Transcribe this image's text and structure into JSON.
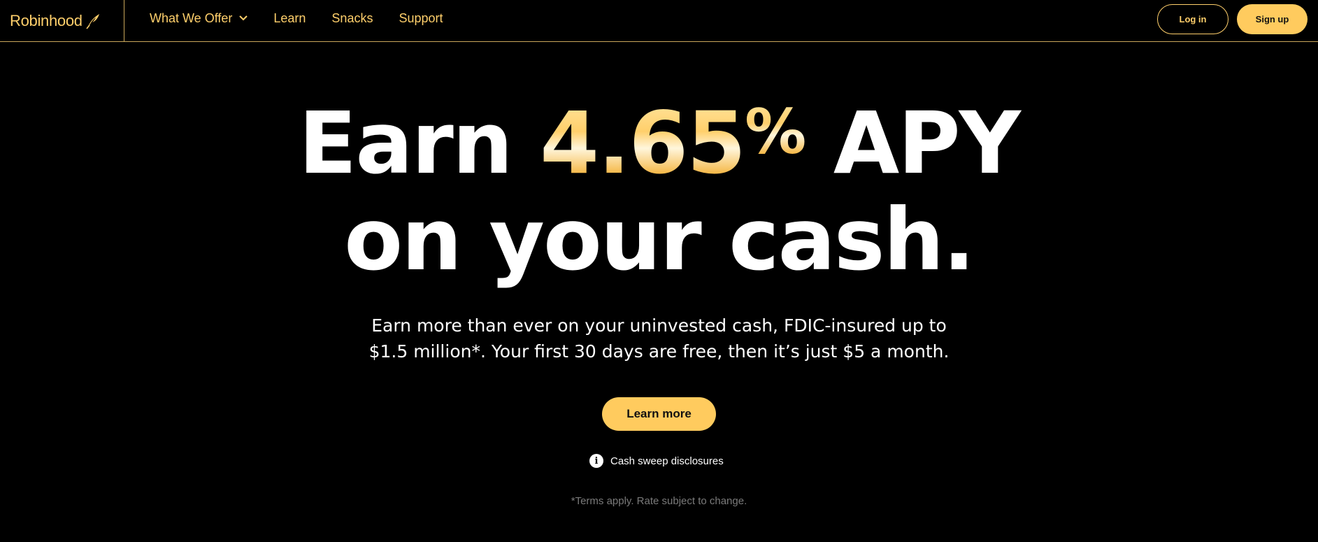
{
  "nav": {
    "brand": "Robinhood",
    "links": [
      {
        "label": "What We Offer",
        "has_dropdown": true
      },
      {
        "label": "Learn",
        "has_dropdown": false
      },
      {
        "label": "Snacks",
        "has_dropdown": false
      },
      {
        "label": "Support",
        "has_dropdown": false
      }
    ],
    "login_label": "Log in",
    "signup_label": "Sign up"
  },
  "hero": {
    "headline_prefix": "Earn ",
    "rate_value": "4.65",
    "rate_symbol": "%",
    "headline_suffix": " APY",
    "headline_line2": "on your cash.",
    "subtext_line1": "Earn more than ever on your uninvested cash, FDIC-insured up to",
    "subtext_line2": "$1.5 million*. Your first 30 days are free, then it’s just $5 a month.",
    "cta_label": "Learn more",
    "disclosure_label": "Cash sweep disclosures",
    "disclosure_icon_glyph": "i",
    "terms": "*Terms apply. Rate subject to change."
  },
  "colors": {
    "background": "#000000",
    "accent": "#ffcb5e",
    "accent_text": "#ffcf6b",
    "text": "#ffffff",
    "muted": "#7a7a7a"
  },
  "icons": {
    "brand_icon": "feather-icon",
    "dropdown_icon": "chevron-down-icon",
    "disclosure_icon": "info-icon"
  }
}
